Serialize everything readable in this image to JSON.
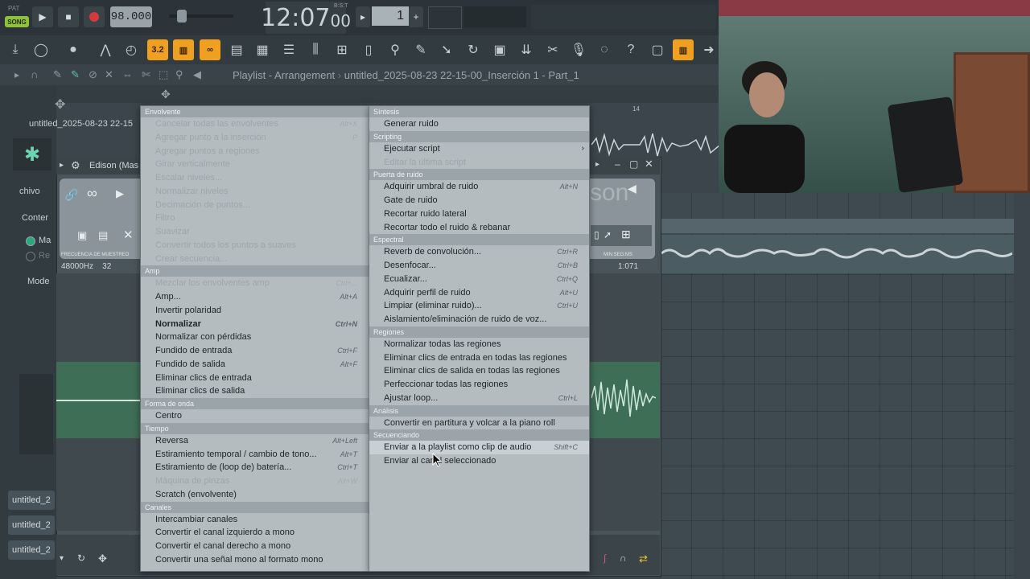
{
  "transport": {
    "pat_label": "PAT",
    "song_label": "SONG",
    "tempo": "98.000",
    "time": "12:07",
    "time_sub": "00",
    "bst": "B:S:T",
    "pattern_number": "1"
  },
  "playlist_bar": {
    "title": "Playlist - Arrangement",
    "file": "untitled_2025-08-23 22-15-00_Inserción 1 - Part_1",
    "ruler_mark": "14"
  },
  "left_panel": {
    "project_title": "untitled_2025-08-23 22-15",
    "archivo_label": "chivo",
    "content_label": "Conter",
    "radio_1": "Ma",
    "radio_2": "Re",
    "mode_label": "Mode",
    "tabs": [
      "untitled_2",
      "untitled_2",
      "untitled_2"
    ]
  },
  "edison": {
    "title": "Edison (Mas",
    "sample_rate": "48000Hz",
    "bits": "32",
    "freq_label": "FRECUENCIA DE MUESTREO",
    "time_label": "MIN:SEG:MS",
    "time_value": "1:071",
    "logo_text": "son"
  },
  "menu_left": {
    "sections": [
      {
        "title": "Envolvente",
        "items": [
          {
            "label": "Cancelar todas las envolventes",
            "shortcut": "Alt+X",
            "disabled": true
          },
          {
            "label": "Agregar punto a la inserción",
            "shortcut": "P",
            "disabled": true
          },
          {
            "label": "Agregar puntos a regiones",
            "shortcut": "",
            "disabled": true
          },
          {
            "label": "Girar verticalmente",
            "shortcut": "",
            "disabled": true
          },
          {
            "label": "Escalar niveles...",
            "shortcut": "",
            "disabled": true
          },
          {
            "label": "Normalizar niveles",
            "shortcut": "",
            "disabled": true
          },
          {
            "label": "Decimación de puntos...",
            "shortcut": "",
            "disabled": true
          },
          {
            "label": "Filtro",
            "shortcut": "",
            "disabled": true
          },
          {
            "label": "Suavizar",
            "shortcut": "",
            "disabled": true
          },
          {
            "label": "Convertir todos los puntos a suaves",
            "shortcut": "",
            "disabled": true
          },
          {
            "label": "Crear secuencia...",
            "shortcut": "",
            "disabled": true
          }
        ]
      },
      {
        "title": "Amp",
        "items": [
          {
            "label": "Mezclar los envolventes amp",
            "shortcut": "Ctrl+...",
            "disabled": true
          },
          {
            "label": "Amp...",
            "shortcut": "Alt+A",
            "disabled": false
          },
          {
            "label": "Invertir polaridad",
            "shortcut": "",
            "disabled": false
          },
          {
            "label": "Normalizar",
            "shortcut": "Ctrl+N",
            "disabled": false,
            "bold": true
          },
          {
            "label": "Normalizar con pérdidas",
            "shortcut": "",
            "disabled": false
          },
          {
            "label": "Fundido de entrada",
            "shortcut": "Ctrl+F",
            "disabled": false
          },
          {
            "label": "Fundido de salida",
            "shortcut": "Alt+F",
            "disabled": false
          },
          {
            "label": "Eliminar clics de entrada",
            "shortcut": "",
            "disabled": false
          },
          {
            "label": "Eliminar clics de salida",
            "shortcut": "",
            "disabled": false
          }
        ]
      },
      {
        "title": "Forma de onda",
        "items": [
          {
            "label": "Centro",
            "shortcut": "",
            "disabled": false
          }
        ]
      },
      {
        "title": "Tiempo",
        "items": [
          {
            "label": "Reversa",
            "shortcut": "Alt+Left",
            "disabled": false
          },
          {
            "label": "Estiramiento temporal / cambio de tono...",
            "shortcut": "Alt+T",
            "disabled": false
          },
          {
            "label": "Estiramiento de (loop de) batería...",
            "shortcut": "Ctrl+T",
            "disabled": false
          },
          {
            "label": "Máquina de pinzas",
            "shortcut": "Alt+W",
            "disabled": true
          },
          {
            "label": "Scratch (envolvente)",
            "shortcut": "",
            "disabled": false
          }
        ]
      },
      {
        "title": "Canales",
        "items": [
          {
            "label": "Intercambiar canales",
            "shortcut": "",
            "disabled": false
          },
          {
            "label": "Convertir el canal izquierdo a mono",
            "shortcut": "",
            "disabled": false
          },
          {
            "label": "Convertir el canal derecho a mono",
            "shortcut": "",
            "disabled": false
          },
          {
            "label": "Convertir una señal mono al formato mono",
            "shortcut": "",
            "disabled": false
          }
        ]
      }
    ]
  },
  "menu_right": {
    "sections": [
      {
        "title": "Síntesis",
        "items": [
          {
            "label": "Generar ruido",
            "shortcut": "",
            "disabled": false
          }
        ]
      },
      {
        "title": "Scripting",
        "items": [
          {
            "label": "Ejecutar script",
            "shortcut": "",
            "disabled": false,
            "submenu": true
          },
          {
            "label": "Editar la última script",
            "shortcut": "",
            "disabled": true
          }
        ]
      },
      {
        "title": "Puerta de ruido",
        "items": [
          {
            "label": "Adquirir umbral de ruido",
            "shortcut": "Alt+N",
            "disabled": false
          },
          {
            "label": "Gate de ruido",
            "shortcut": "",
            "disabled": false
          },
          {
            "label": "Recortar ruido lateral",
            "shortcut": "",
            "disabled": false
          },
          {
            "label": "Recortar todo el ruido & rebanar",
            "shortcut": "",
            "disabled": false
          }
        ]
      },
      {
        "title": "Espectral",
        "items": [
          {
            "label": "Reverb de convolución...",
            "shortcut": "Ctrl+R",
            "disabled": false
          },
          {
            "label": "Desenfocar...",
            "shortcut": "Ctrl+B",
            "disabled": false
          },
          {
            "label": "Ecualizar...",
            "shortcut": "Ctrl+Q",
            "disabled": false
          },
          {
            "label": "Adquirir perfil de ruido",
            "shortcut": "Alt+U",
            "disabled": false
          },
          {
            "label": "Limpiar (eliminar ruido)...",
            "shortcut": "Ctrl+U",
            "disabled": false
          },
          {
            "label": "Aislamiento/eliminación de ruido de voz...",
            "shortcut": "",
            "disabled": false
          }
        ]
      },
      {
        "title": "Regiones",
        "items": [
          {
            "label": "Normalizar todas las regiones",
            "shortcut": "",
            "disabled": false
          },
          {
            "label": "Eliminar clics de entrada en todas las regiones",
            "shortcut": "",
            "disabled": false
          },
          {
            "label": "Eliminar clics de salida en todas las regiones",
            "shortcut": "",
            "disabled": false
          },
          {
            "label": "Perfeccionar todas las regiones",
            "shortcut": "",
            "disabled": false
          },
          {
            "label": "Ajustar loop...",
            "shortcut": "Ctrl+L",
            "disabled": false
          }
        ]
      },
      {
        "title": "Análisis",
        "items": [
          {
            "label": "Convertir en partitura y volcar a la piano roll",
            "shortcut": "",
            "disabled": false
          }
        ]
      },
      {
        "title": "Secuenciando",
        "items": [
          {
            "label": "Enviar a la playlist como clip de audio",
            "shortcut": "Shift+C",
            "disabled": false,
            "highlighted": true
          },
          {
            "label": "Enviar al canal seleccionado",
            "shortcut": "",
            "disabled": false
          }
        ]
      }
    ]
  }
}
